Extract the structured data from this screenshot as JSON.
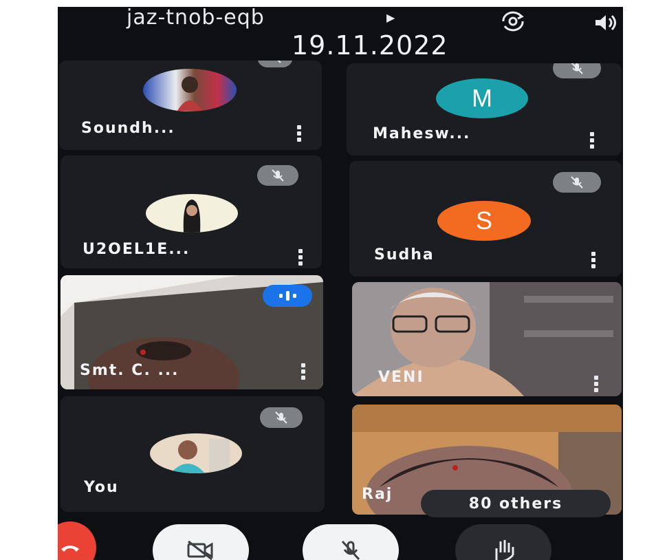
{
  "header": {
    "meeting_code": "jaz-tnob-eqb",
    "date": "19.11.2022"
  },
  "participants": [
    {
      "name": "Soundh...",
      "avatar": "photo",
      "mic": "muted"
    },
    {
      "name": "Mahesw...",
      "avatar": "letter",
      "letter": "M",
      "color": "#1aa1ab",
      "mic": "muted"
    },
    {
      "name": "U2OEL1E...",
      "avatar": "photo",
      "mic": "muted"
    },
    {
      "name": "Sudha",
      "avatar": "letter",
      "letter": "S",
      "color": "#f26b21",
      "mic": "muted"
    },
    {
      "name": "Smt. C. ...",
      "avatar": "video",
      "mic": "speaking"
    },
    {
      "name": "VENI",
      "avatar": "video",
      "mic": "unmuted"
    },
    {
      "name": "You",
      "avatar": "photo",
      "mic": "muted"
    },
    {
      "name": "Raj",
      "avatar": "video",
      "mic": "unmuted"
    }
  ],
  "others_label": "80 others",
  "controls": [
    "end-call",
    "camera-off",
    "mic-off",
    "raise-hand"
  ],
  "colors": {
    "background": "#0d0f12",
    "tile": "#1b1d20",
    "speaking": "#1a73e8",
    "end_call": "#ea4335"
  }
}
